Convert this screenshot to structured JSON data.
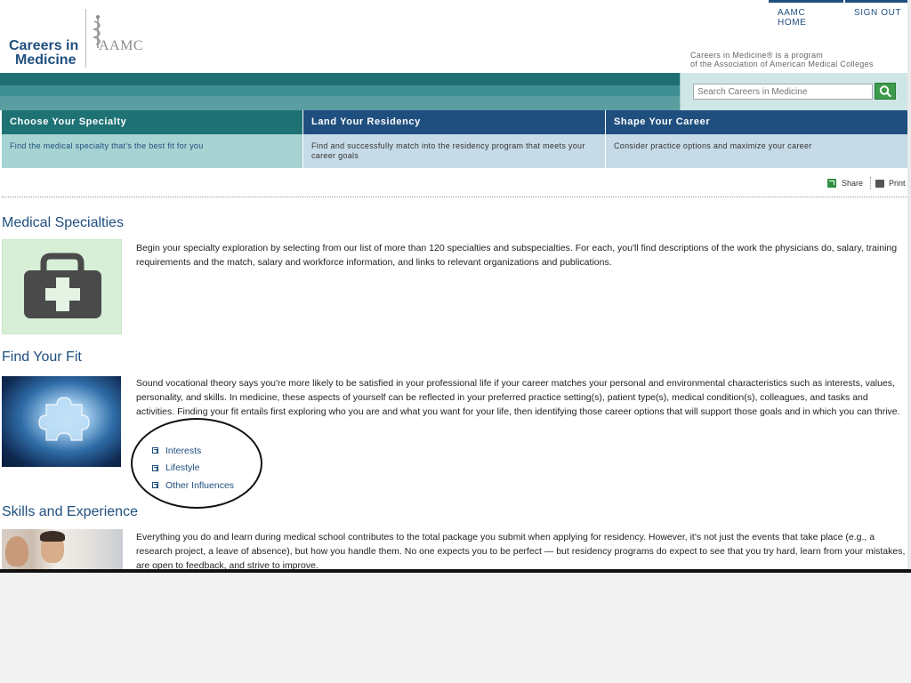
{
  "header": {
    "logo_line1": "Careers in",
    "logo_line2": "Medicine",
    "aamc_mark": "AAMC",
    "top_links": [
      "AAMC HOME",
      "SIGN OUT"
    ],
    "program_note_line1": "Careers in Medicine® is a program",
    "program_note_line2": "of the Association of American Medical Colleges",
    "search_placeholder": "Search Careers in Medicine"
  },
  "nav": [
    {
      "title": "Choose Your Specialty",
      "desc": "Find the medical specialty that's the best fit for you"
    },
    {
      "title": "Land Your Residency",
      "desc": "Find and successfully match into the residency program that meets your career goals"
    },
    {
      "title": "Shape Your Career",
      "desc": "Consider practice options and maximize your career"
    }
  ],
  "tools": {
    "share": "Share",
    "print": "Print"
  },
  "sections": [
    {
      "title": "Medical Specialties",
      "text": "Begin your specialty exploration by selecting from our list of more than 120 specialties and subspecialties. For each, you'll find descriptions of the work the physicians do, salary, training requirements and the match, salary and workforce information, and links to relevant organizations and publications."
    },
    {
      "title": "Find Your Fit",
      "text": "Sound vocational theory says you're more likely to be satisfied in your professional life if your career matches your personal and environmental characteristics such as interests, values, personality, and skills. In medicine, these aspects of yourself can be reflected in your preferred practice setting(s), patient type(s), medical condition(s), colleagues, and tasks and activities. Finding your fit entails first exploring who you are and what you want for your life, then identifying those career options that will support those goals and in which you can thrive.",
      "links": [
        "Interests",
        "Lifestyle",
        "Other Influences"
      ]
    },
    {
      "title": "Skills and Experience",
      "text": "Everything you do and learn during medical school contributes to the total package you submit when applying for residency. However, it's not just the events that take place (e.g., a research project, a leave of absence), but how you handle them. No one expects you to be perfect — but residency programs do expect to see that you try hard, learn from your mistakes, are open to feedback, and strive to improve."
    }
  ],
  "colors": {
    "brand_blue": "#1f4f7e",
    "teal": "#1e7274",
    "search_green": "#3c9a4c"
  }
}
